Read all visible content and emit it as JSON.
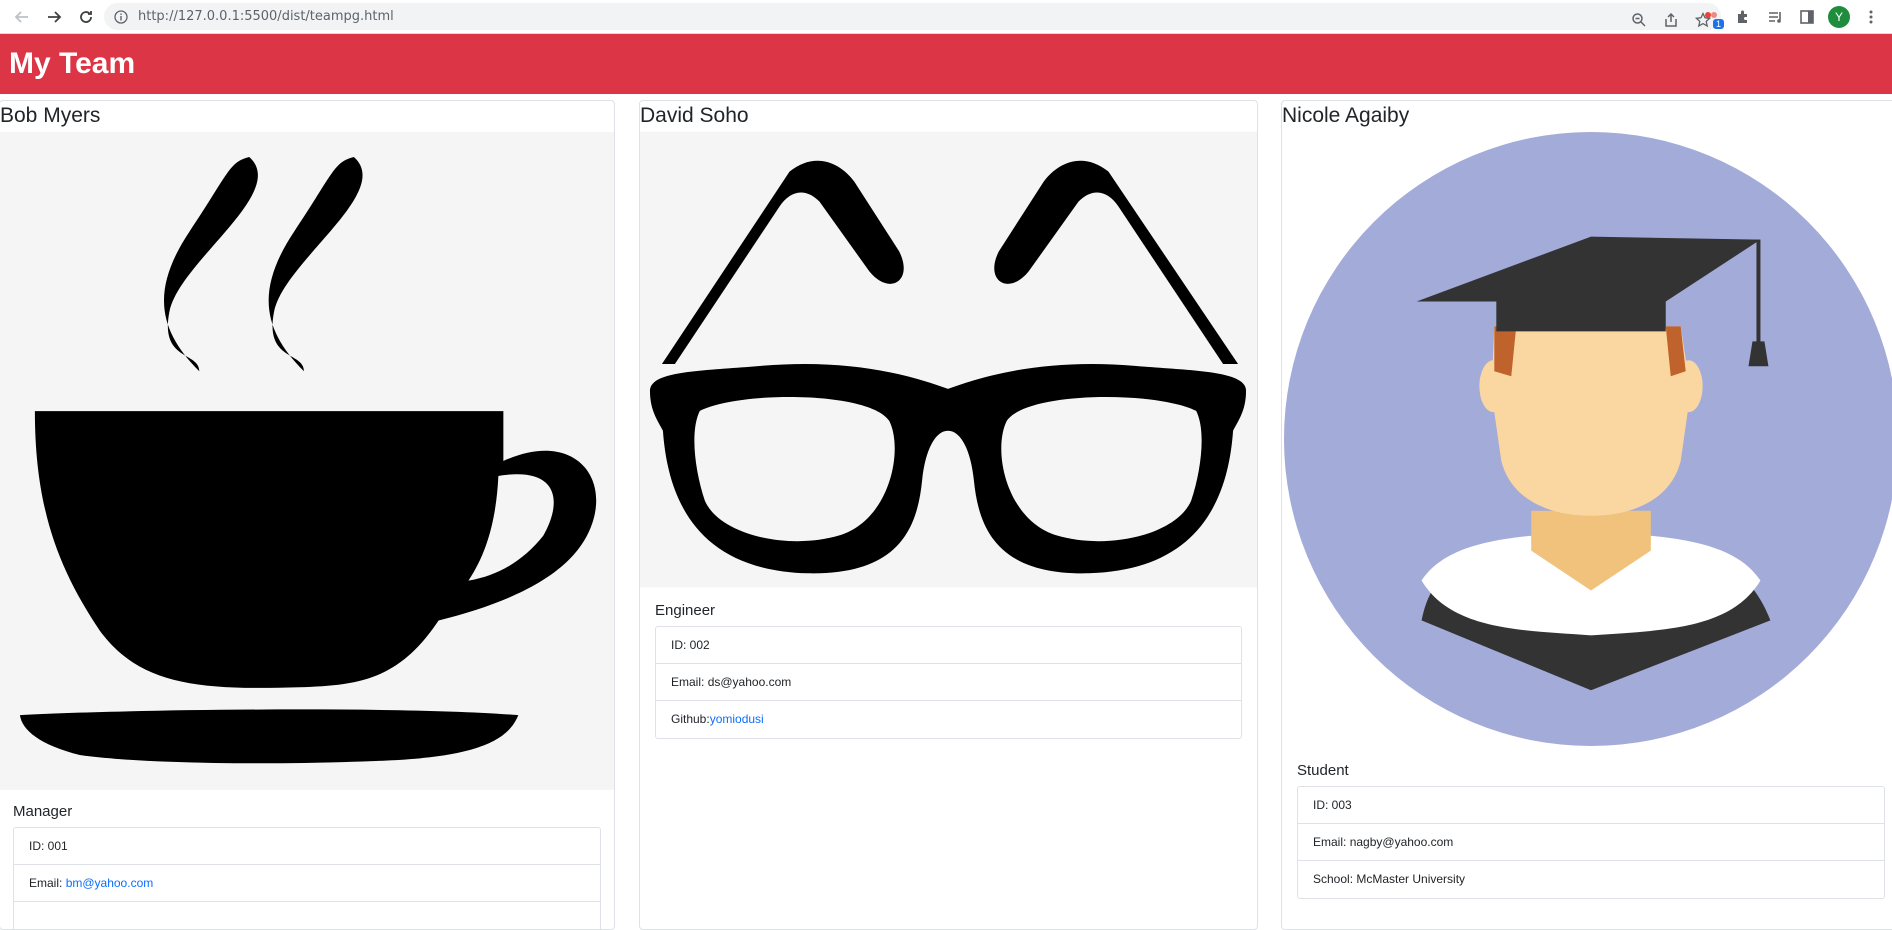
{
  "browser": {
    "url": "http://127.0.0.1:5500/dist/teampg.html",
    "extension_badge": "1",
    "profile_initial": "Y"
  },
  "header": {
    "title": "My Team",
    "color": "#dc3545"
  },
  "team": [
    {
      "name": "Bob Myers",
      "role": "Manager",
      "image": "coffee-cup-icon",
      "id_label": "ID: ",
      "id": "001",
      "email_label": "Email: ",
      "email": "bm@yahoo.com"
    },
    {
      "name": "David Soho",
      "role": "Engineer",
      "image": "glasses-icon",
      "id_label": "ID: ",
      "id": "002",
      "email_label": "Email: ",
      "email": "ds@yahoo.com",
      "github_label": "Github:",
      "github": "yomiodusi"
    },
    {
      "name": "Nicole Agaiby",
      "role": "Student",
      "image": "graduate-icon",
      "id_label": "ID: ",
      "id": "003",
      "email_label": "Email: ",
      "email": "nagby@yahoo.com",
      "school_label": "School: ",
      "school": "McMaster University"
    }
  ]
}
